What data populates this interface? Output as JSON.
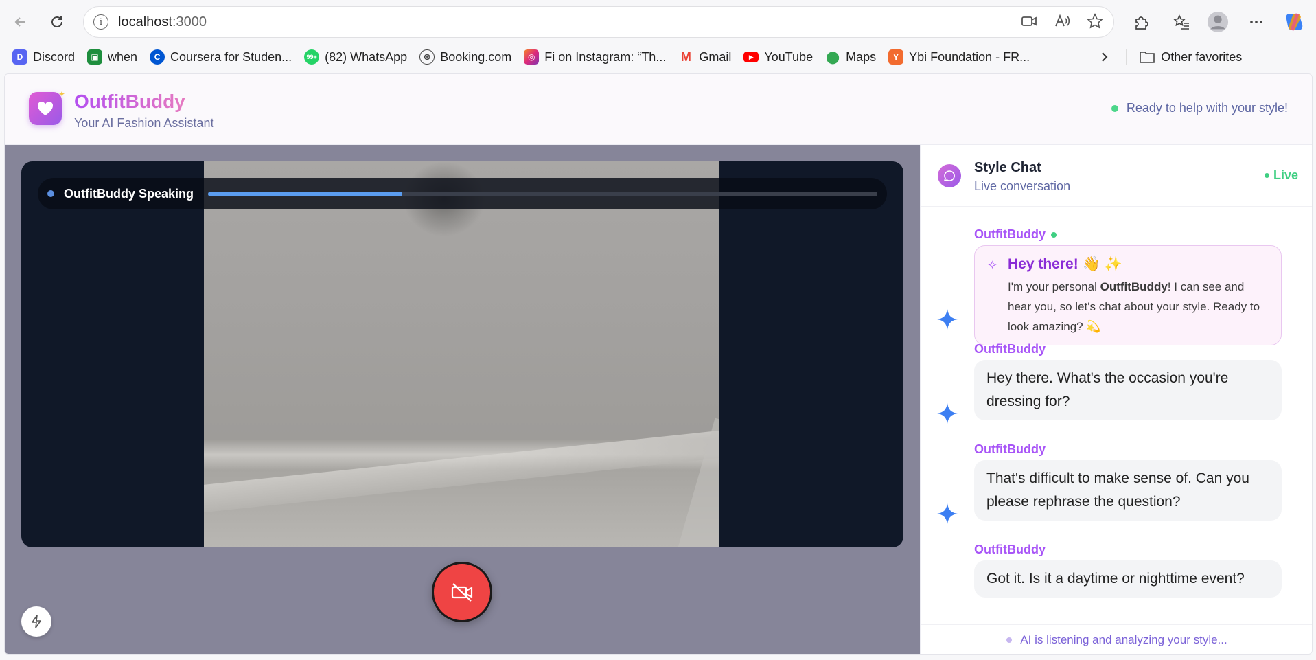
{
  "browser": {
    "url_host": "localhost",
    "url_port": ":3000",
    "bookmarks": [
      {
        "label": "Discord",
        "icon": "discord-icon",
        "color": "#5865f2"
      },
      {
        "label": "when",
        "icon": "classroom-icon",
        "color": "#1e8e3e"
      },
      {
        "label": "Coursera for Studen...",
        "icon": "coursera-icon",
        "color": "#0056d2"
      },
      {
        "label": "(82) WhatsApp",
        "icon": "whatsapp-icon",
        "color": "#25d366"
      },
      {
        "label": "Booking.com",
        "icon": "globe-icon",
        "color": "#444444"
      },
      {
        "label": "Fi on Instagram: “Th...",
        "icon": "instagram-icon",
        "color": "#d62976"
      },
      {
        "label": "Gmail",
        "icon": "gmail-icon",
        "color": "#ea4335"
      },
      {
        "label": "YouTube",
        "icon": "youtube-icon",
        "color": "#ff0000"
      },
      {
        "label": "Maps",
        "icon": "maps-icon",
        "color": "#34a853"
      },
      {
        "label": "Ybi Foundation - FR...",
        "icon": "ybi-icon",
        "color": "#f26b2f"
      }
    ],
    "other_favorites": "Other favorites"
  },
  "app": {
    "brand": "OutfitBuddy",
    "tagline": "Your AI Fashion Assistant",
    "status": "Ready to help with your style!"
  },
  "video": {
    "speaking_label": "OutfitBuddy Speaking",
    "speaking_progress": 0.29
  },
  "chat": {
    "title": "Style Chat",
    "subtitle": "Live conversation",
    "live_label": "Live",
    "welcome": {
      "sender": "OutfitBuddy",
      "title": "Hey there! 👋 ✨",
      "text_before": "I'm your personal ",
      "text_bold": "OutfitBuddy",
      "text_after": "! I can see and hear you, so let's chat about your style. Ready to look amazing? 💫"
    },
    "messages": [
      {
        "sender": "OutfitBuddy",
        "text": "Hey there. What's the occasion you're dressing for?"
      },
      {
        "sender": "OutfitBuddy",
        "text": "That's difficult to make sense of. Can you please rephrase the question?"
      },
      {
        "sender": "OutfitBuddy",
        "text": "Got it. Is it a daytime or nighttime event?"
      }
    ],
    "listening": "AI is listening and analyzing your style..."
  },
  "colors": {
    "accent": "#a855f7",
    "live": "#3fcf82",
    "end_call": "#ef4444",
    "progress": "#5b9df0"
  }
}
